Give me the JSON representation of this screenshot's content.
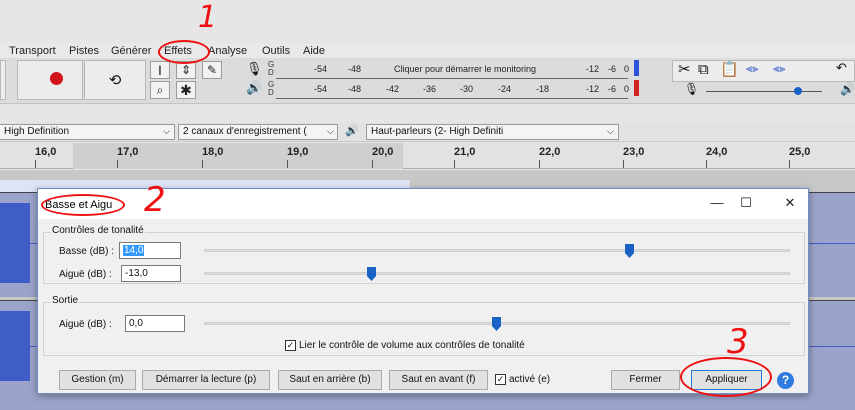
{
  "menu": [
    "Transport",
    "Pistes",
    "Générer",
    "Effets",
    "Analyse",
    "Outils",
    "Aide"
  ],
  "meters": {
    "record_ticks": [
      "-54",
      "-48",
      "-12",
      "-6",
      "0"
    ],
    "record_prompt": "Cliquer pour démarrer le monitoring",
    "play_ticks": [
      "-54",
      "-48",
      "-42",
      "-36",
      "-30",
      "-24",
      "-18",
      "-12",
      "-6",
      "0"
    ],
    "channel_left": "G",
    "channel_right": "D"
  },
  "device_bar": {
    "host": "High Definition",
    "channels": "2 canaux d'enregistrement ( ",
    "output": "Haut-parleurs (2- High Definiti"
  },
  "ruler": {
    "labels": [
      "16,0",
      "17,0",
      "18,0",
      "19,0",
      "20,0",
      "21,0",
      "22,0",
      "23,0",
      "24,0",
      "25,0"
    ]
  },
  "dialog": {
    "title": "Basse et Aigu",
    "window_controls": {
      "minimize": "—",
      "maximize": "☐",
      "close": "✕"
    },
    "tone_group": {
      "title": "Contrôles de tonalité",
      "bass": {
        "label": "Basse (dB) :",
        "value": "14,0",
        "slider_fraction": 0.72
      },
      "treble": {
        "label": "Aiguë (dB) :",
        "value": "-13,0",
        "slider_fraction": 0.28
      }
    },
    "output_group": {
      "title": "Sortie",
      "gain": {
        "label": "Aiguë (dB) :",
        "value": "0,0",
        "slider_fraction": 0.5
      },
      "link_checkbox": {
        "label": "Lier le contrôle de volume aux contrôles de tonalité",
        "checked": true
      }
    },
    "buttons": {
      "manage": "Gestion (m)",
      "preview": "Démarrer la lecture (p)",
      "skip_back": "Saut en arrière (b)",
      "skip_forward": "Saut en avant (f)",
      "enabled_label": "activé (e)",
      "close": "Fermer",
      "apply": "Appliquer",
      "help": "?"
    }
  },
  "annotations": {
    "one": "1",
    "two": "2",
    "three": "3"
  },
  "colors": {
    "accent": "#1b62c7",
    "record": "#d0151d",
    "annotation": "#e11111",
    "waveform": "#3f5cc7"
  }
}
